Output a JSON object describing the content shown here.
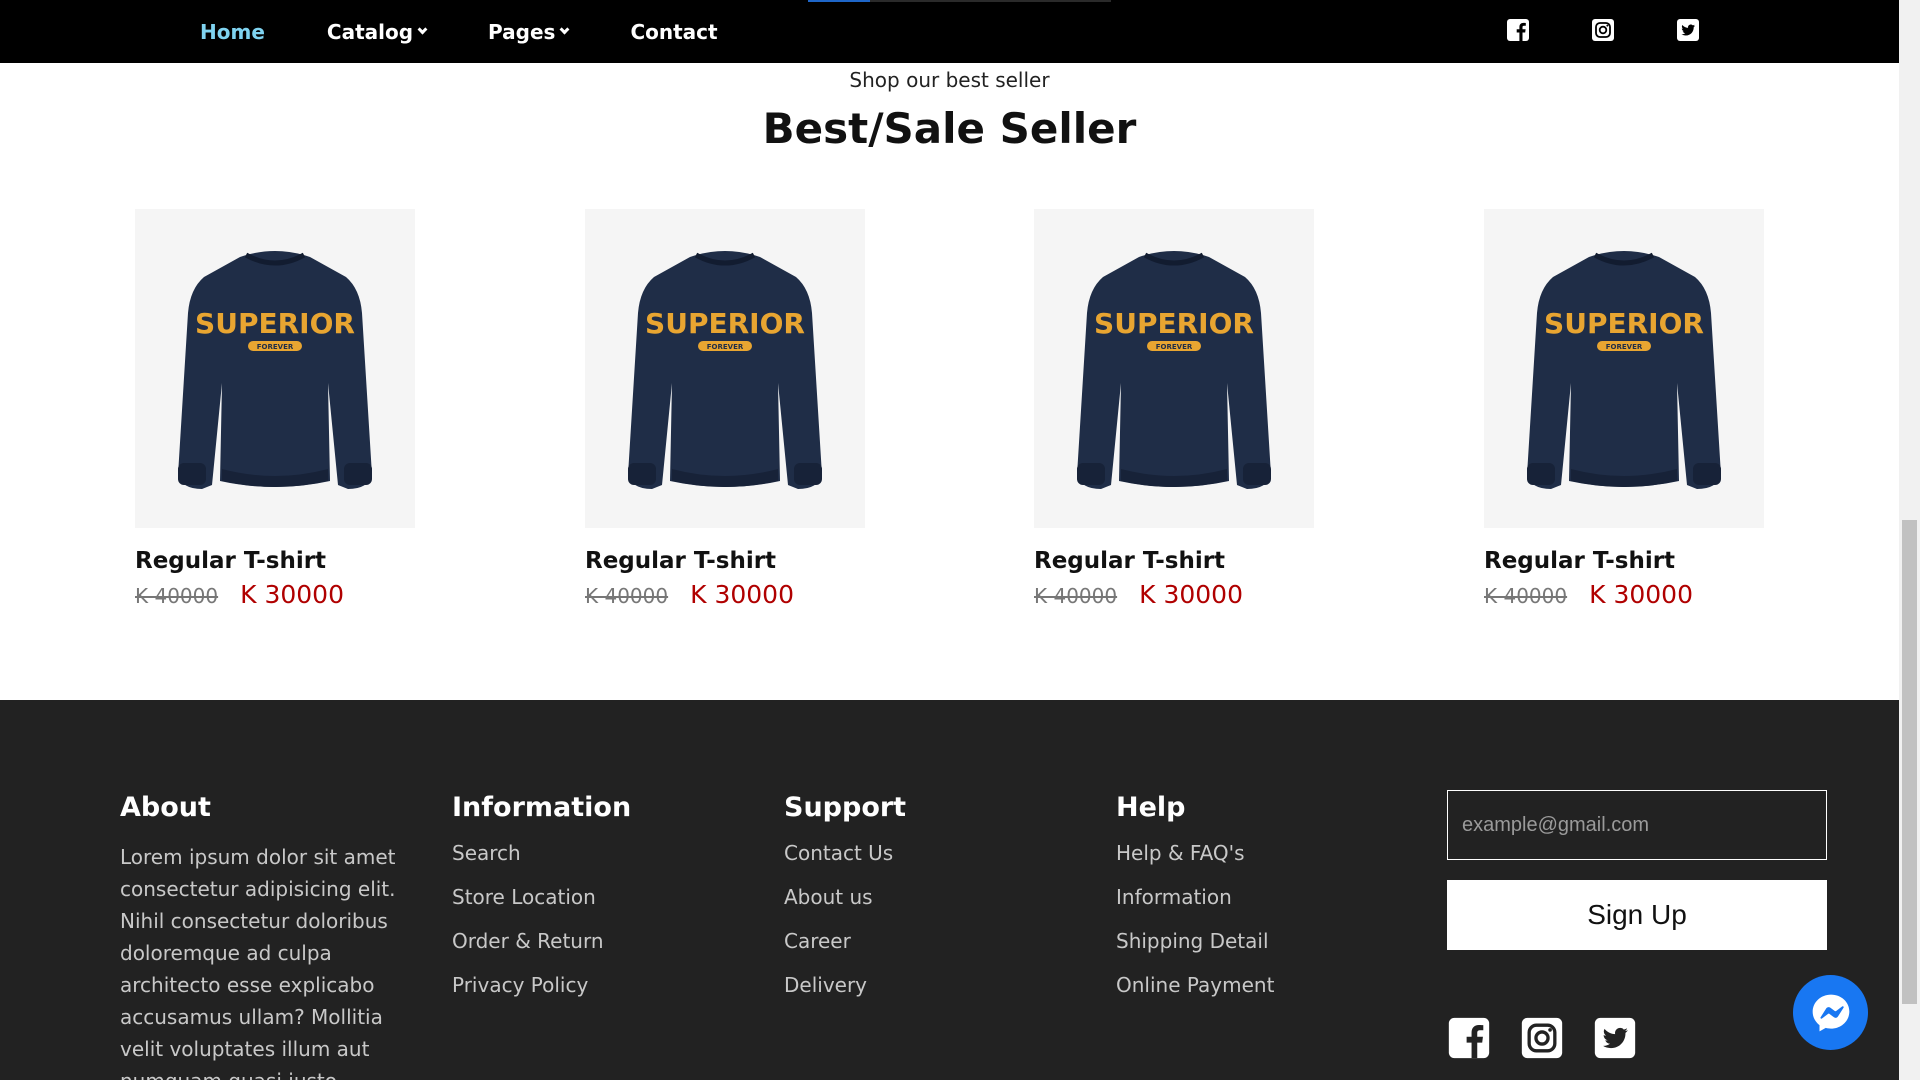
{
  "nav": {
    "items": [
      {
        "label": "Home",
        "active": true,
        "has_dropdown": false
      },
      {
        "label": "Catalog",
        "active": false,
        "has_dropdown": true
      },
      {
        "label": "Pages",
        "active": false,
        "has_dropdown": true
      },
      {
        "label": "Contact",
        "active": false,
        "has_dropdown": false
      }
    ],
    "social_icons": [
      "facebook-icon",
      "instagram-icon",
      "twitter-icon"
    ],
    "active_color": "#7fd3f0"
  },
  "section": {
    "subtitle": "Shop our best seller",
    "title": "Best/Sale Seller"
  },
  "products": [
    {
      "name": "Regular T-shirt",
      "old_price": "K 40000",
      "new_price": "K 30000"
    },
    {
      "name": "Regular T-shirt",
      "old_price": "K 40000",
      "new_price": "K 30000"
    },
    {
      "name": "Regular T-shirt",
      "old_price": "K 40000",
      "new_price": "K 30000"
    },
    {
      "name": "Regular T-shirt",
      "old_price": "K 40000",
      "new_price": "K 30000"
    }
  ],
  "product_image": {
    "brand_text": "SUPERIOR",
    "sub_text": "FOREVER",
    "garment_color": "#1f2d47",
    "print_color": "#e8a531"
  },
  "stray_mark": ",",
  "footer": {
    "about": {
      "heading": "About",
      "text": "Lorem ipsum dolor sit amet consectetur adipisicing elit. Nihil consectetur doloribus doloremque ad culpa architecto esse explicabo accusamus ullam? Mollitia velit voluptates illum aut numquam quasi iusto"
    },
    "information": {
      "heading": "Information",
      "links": [
        "Search",
        "Store Location",
        "Order & Return",
        "Privacy Policy"
      ]
    },
    "support": {
      "heading": "Support",
      "links": [
        "Contact Us",
        "About us",
        "Career",
        "Delivery"
      ]
    },
    "help": {
      "heading": "Help",
      "links": [
        "Help & FAQ's",
        "Information",
        "Shipping Detail",
        "Online Payment"
      ]
    },
    "newsletter": {
      "placeholder": "example@gmail.com",
      "button": "Sign Up"
    },
    "social_icons": [
      "facebook-icon",
      "instagram-icon",
      "twitter-icon"
    ],
    "background": "#222222"
  },
  "messenger": {
    "icon": "messenger-icon",
    "color": "#1877f2"
  },
  "price_color": "#b00000"
}
